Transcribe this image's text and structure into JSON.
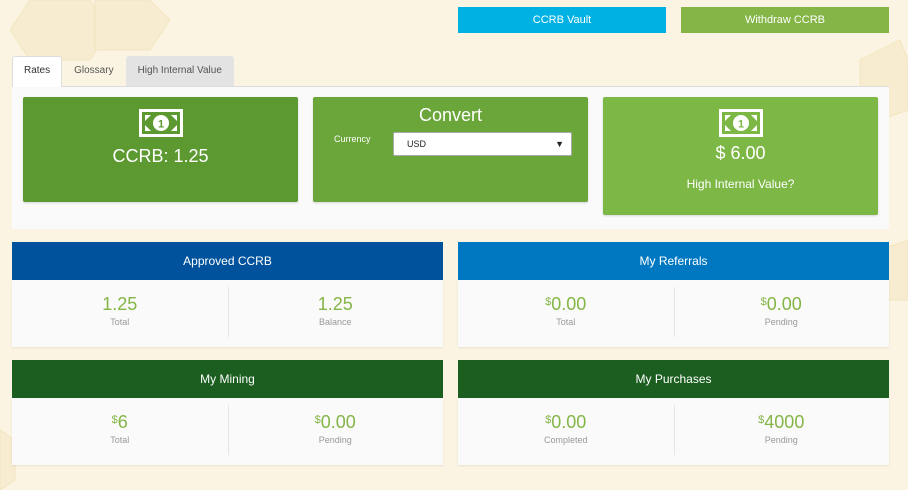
{
  "colors": {
    "vault_button": "#00b2e3",
    "withdraw_button": "#84b546",
    "approved_header": "#00529c",
    "referrals_header": "#0078c1",
    "mining_header": "#1b5e20",
    "purchases_header": "#1b5e20",
    "value_green": "#84b546",
    "background": "#fbf4e2"
  },
  "top_buttons": {
    "vault_label": "CCRB Vault",
    "withdraw_label": "Withdraw CCRB"
  },
  "tabs": [
    {
      "label": "Rates",
      "active": true
    },
    {
      "label": "Glossary",
      "active": false
    },
    {
      "label": "High Internal Value",
      "active": false
    }
  ],
  "rates": {
    "ccrb_card": {
      "icon": "dollar-bill-icon",
      "text": "CCRB: 1.25"
    },
    "convert_card": {
      "title": "Convert",
      "currency_label": "Currency",
      "currency_selected": "USD"
    },
    "hiv_card": {
      "icon": "dollar-bill-icon",
      "amount": "$ 6.00",
      "label": "High Internal Value?"
    }
  },
  "approved": {
    "title": "Approved CCRB",
    "total_value": "1.25",
    "total_label": "Total",
    "balance_value": "1.25",
    "balance_label": "Balance"
  },
  "referrals": {
    "title": "My Referrals",
    "currency": "$",
    "total_value": "0.00",
    "total_label": "Total",
    "pending_value": "0.00",
    "pending_label": "Pending"
  },
  "mining": {
    "title": "My Mining",
    "currency": "$",
    "total_value": "6",
    "total_label": "Total",
    "pending_value": "0.00",
    "pending_label": "Pending"
  },
  "purchases": {
    "title": "My Purchases",
    "currency": "$",
    "completed_value": "0.00",
    "completed_label": "Completed",
    "pending_value": "4000",
    "pending_label": "Pending"
  }
}
